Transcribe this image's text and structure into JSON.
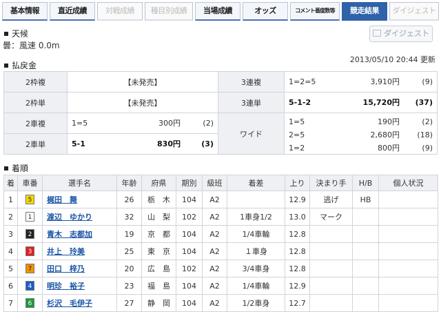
{
  "tabs": [
    {
      "label": "基本情報",
      "state": "normal"
    },
    {
      "label": "直近成績",
      "state": "normal"
    },
    {
      "label": "対戦成績",
      "state": "disabled"
    },
    {
      "label": "種目別成績",
      "state": "disabled"
    },
    {
      "label": "当場成績",
      "state": "normal"
    },
    {
      "label": "オッズ",
      "state": "normal"
    },
    {
      "label": "コメント番度数等",
      "state": "small"
    },
    {
      "label": "競走結果",
      "state": "active"
    },
    {
      "label": "ダイジェスト",
      "state": "disabled"
    }
  ],
  "weather": {
    "heading": "天候",
    "value": "曇：風速 0.0m"
  },
  "digest_button": "ダイジェスト",
  "updated": "2013/05/10 20:44 更新",
  "payout": {
    "heading": "払戻金",
    "waku_fuku": {
      "label": "2枠複",
      "value": "【未発売】"
    },
    "waku_tan": {
      "label": "2枠単",
      "value": "【未発売】"
    },
    "sanrenpuku": {
      "label": "3連複",
      "combo": "1=2=5",
      "yen": "3,910円",
      "pop": "(9)"
    },
    "sanrentan": {
      "label": "3連単",
      "combo": "5-1-2",
      "yen": "15,720円",
      "pop": "(37)"
    },
    "nishafuku": {
      "label": "2車複",
      "combo": "1=5",
      "yen": "300円",
      "pop": "(2)"
    },
    "nishatan": {
      "label": "2車単",
      "combo": "5-1",
      "yen": "830円",
      "pop": "(3)"
    },
    "wide": {
      "label": "ワイド",
      "rows": [
        {
          "combo": "1=5",
          "yen": "190円",
          "pop": "(2)"
        },
        {
          "combo": "2=5",
          "yen": "2,680円",
          "pop": "(18)"
        },
        {
          "combo": "1=2",
          "yen": "800円",
          "pop": "(9)"
        }
      ]
    }
  },
  "results": {
    "heading": "着順",
    "columns": [
      "着",
      "車番",
      "選手名",
      "年齢",
      "府県",
      "期別",
      "級班",
      "着差",
      "上り",
      "決まり手",
      "H/B",
      "個人状況"
    ],
    "rows": [
      {
        "pos": "1",
        "car": "5",
        "bg": "#f5d800",
        "fg": "#222",
        "name": "梶田　舞",
        "age": "26",
        "pref": "栃　木",
        "term": "104",
        "cls": "A2",
        "diff": "",
        "last": "12.9",
        "kimari": "逃げ",
        "hb": "HB",
        "status": ""
      },
      {
        "pos": "2",
        "car": "1",
        "bg": "#ffffff",
        "fg": "#222",
        "name": "渡辺　ゆかり",
        "age": "32",
        "pref": "山　梨",
        "term": "102",
        "cls": "A2",
        "diff": "1車身1/2",
        "last": "13.0",
        "kimari": "マーク",
        "hb": "",
        "status": ""
      },
      {
        "pos": "3",
        "car": "2",
        "bg": "#222222",
        "fg": "#fff",
        "name": "青木　志都加",
        "age": "19",
        "pref": "京　都",
        "term": "104",
        "cls": "A2",
        "diff": "1/4車輪",
        "last": "12.8",
        "kimari": "",
        "hb": "",
        "status": ""
      },
      {
        "pos": "4",
        "car": "3",
        "bg": "#e02020",
        "fg": "#fff",
        "name": "井上　玲美",
        "age": "25",
        "pref": "東　京",
        "term": "104",
        "cls": "A2",
        "diff": "１車身",
        "last": "12.8",
        "kimari": "",
        "hb": "",
        "status": ""
      },
      {
        "pos": "5",
        "car": "7",
        "bg": "#f29100",
        "fg": "#222",
        "name": "田口　梓乃",
        "age": "20",
        "pref": "広　島",
        "term": "102",
        "cls": "A2",
        "diff": "3/4車身",
        "last": "12.8",
        "kimari": "",
        "hb": "",
        "status": ""
      },
      {
        "pos": "6",
        "car": "4",
        "bg": "#1e5bc6",
        "fg": "#fff",
        "name": "明珍　裕子",
        "age": "23",
        "pref": "福　島",
        "term": "104",
        "cls": "A2",
        "diff": "1/4車輪",
        "last": "12.9",
        "kimari": "",
        "hb": "",
        "status": ""
      },
      {
        "pos": "7",
        "car": "6",
        "bg": "#1a9a3a",
        "fg": "#fff",
        "name": "杉沢　毛伊子",
        "age": "27",
        "pref": "静　岡",
        "term": "104",
        "cls": "A2",
        "diff": "1/2車身",
        "last": "12.7",
        "kimari": "",
        "hb": "",
        "status": ""
      }
    ]
  }
}
